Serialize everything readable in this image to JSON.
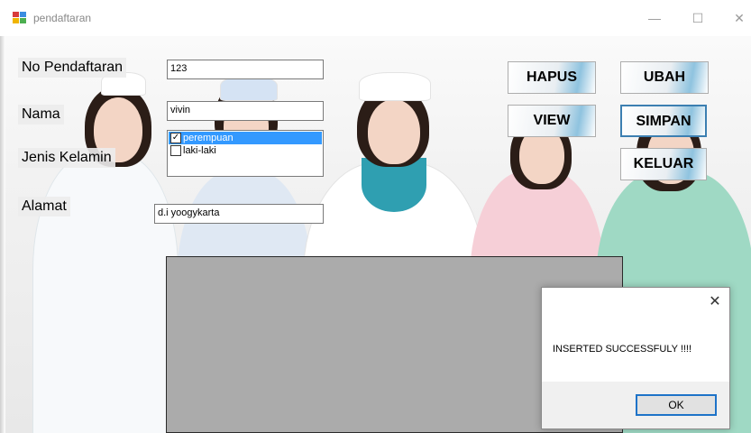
{
  "window": {
    "title": "pendaftaran",
    "controls": {
      "minimize": "—",
      "maximize": "☐",
      "close": "✕"
    }
  },
  "form": {
    "no_pendaftaran": {
      "label": "No Pendaftaran",
      "value": "123"
    },
    "nama": {
      "label": "Nama",
      "value": "vivin"
    },
    "jenis_kelamin": {
      "label": "Jenis Kelamin",
      "options": [
        {
          "label": "perempuan",
          "checked": true,
          "selected": true
        },
        {
          "label": "laki-laki",
          "checked": false,
          "selected": false
        }
      ]
    },
    "alamat": {
      "label": "Alamat",
      "value": "d.i yoogykarta"
    }
  },
  "buttons": {
    "hapus": "HAPUS",
    "ubah": "UBAH",
    "view": "VIEW",
    "simpan": "SIMPAN",
    "keluar": "KELUAR"
  },
  "dialog": {
    "close": "✕",
    "message": "INSERTED SUCCESSFULY !!!!",
    "ok": "OK"
  },
  "colors": {
    "selection": "#3399ff",
    "focus_border": "#3c7fb1",
    "grid_panel": "#ababab",
    "ok_border": "#1e73c8"
  }
}
